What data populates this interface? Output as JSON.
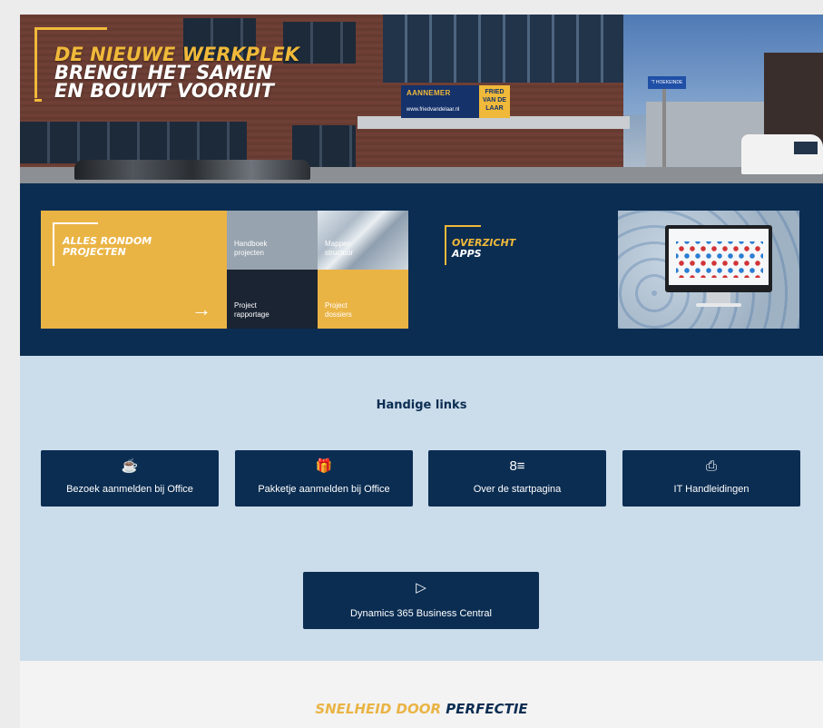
{
  "hero": {
    "line1": "DE NIEUWE WERKPLEK",
    "line2": "BRENGT HET SAMEN",
    "line3": "EN BOUWT VOORUIT",
    "sign_aannemer": "AANNEMER",
    "sign_url": "www.friedvandelaar.nl",
    "sign_name": [
      "FRIED",
      "VAN DE",
      "LAAR"
    ],
    "street_sign": "'T HOEKEINDE"
  },
  "projects": {
    "title_line1": "ALLES RONDOM",
    "title_line2": "PROJECTEN",
    "arrow": "→",
    "tiles": [
      {
        "line1": "Handboek",
        "line2": "projecten"
      },
      {
        "line1": "Mappen",
        "line2": "structuur"
      },
      {
        "line1": "Project",
        "line2": "rapportage"
      },
      {
        "line1": "Project",
        "line2": "dossiers"
      }
    ]
  },
  "apps": {
    "title_line1": "OVERZICHT",
    "title_line2": "APPS"
  },
  "links": {
    "title": "Handige links",
    "buttons": [
      {
        "label": "Bezoek aanmelden bij Office",
        "icon": "☕"
      },
      {
        "label": "Pakketje aanmelden bij Office",
        "icon": "🎁"
      },
      {
        "label": "Over de startpagina",
        "icon": "8≡"
      },
      {
        "label": "IT Handleidingen",
        "icon": "⎙"
      },
      {
        "label": "Dynamics 365 Business Central",
        "icon": "▷"
      }
    ]
  },
  "footer": {
    "slogan_part1": "SNELHEID DOOR",
    "slogan_part2": "PERFECTIE"
  },
  "colors": {
    "navy": "#0b2d52",
    "yellow": "#eab445",
    "light_blue": "#cbdceb"
  }
}
